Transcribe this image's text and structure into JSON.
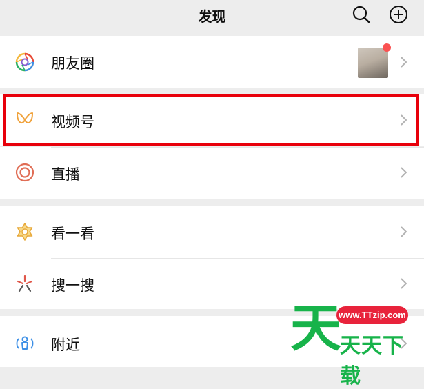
{
  "header": {
    "title": "发现",
    "search_icon": "search-icon",
    "add_icon": "plus-circle-icon"
  },
  "menu": {
    "moments": {
      "label": "朋友圈",
      "icon": "moments-aperture-icon",
      "badge": "red-dot"
    },
    "channels": {
      "label": "视频号",
      "icon": "channels-butterfly-icon"
    },
    "live": {
      "label": "直播",
      "icon": "live-rings-icon"
    },
    "top_stories": {
      "label": "看一看",
      "icon": "top-stories-star-icon"
    },
    "search": {
      "label": "搜一搜",
      "icon": "search-sparkle-icon"
    },
    "nearby": {
      "label": "附近",
      "icon": "nearby-person-icon"
    }
  },
  "watermark": {
    "url": "www.TTzip.com",
    "big_char": "天",
    "text": "天天下载"
  },
  "colors": {
    "background": "#ededed",
    "highlight_border": "#e8000b",
    "badge": "#fa5151",
    "channels_icon": "#f0a23b",
    "live_icon": "#e06d55",
    "watermark_green": "#17b34a",
    "watermark_red": "#e8233b"
  }
}
